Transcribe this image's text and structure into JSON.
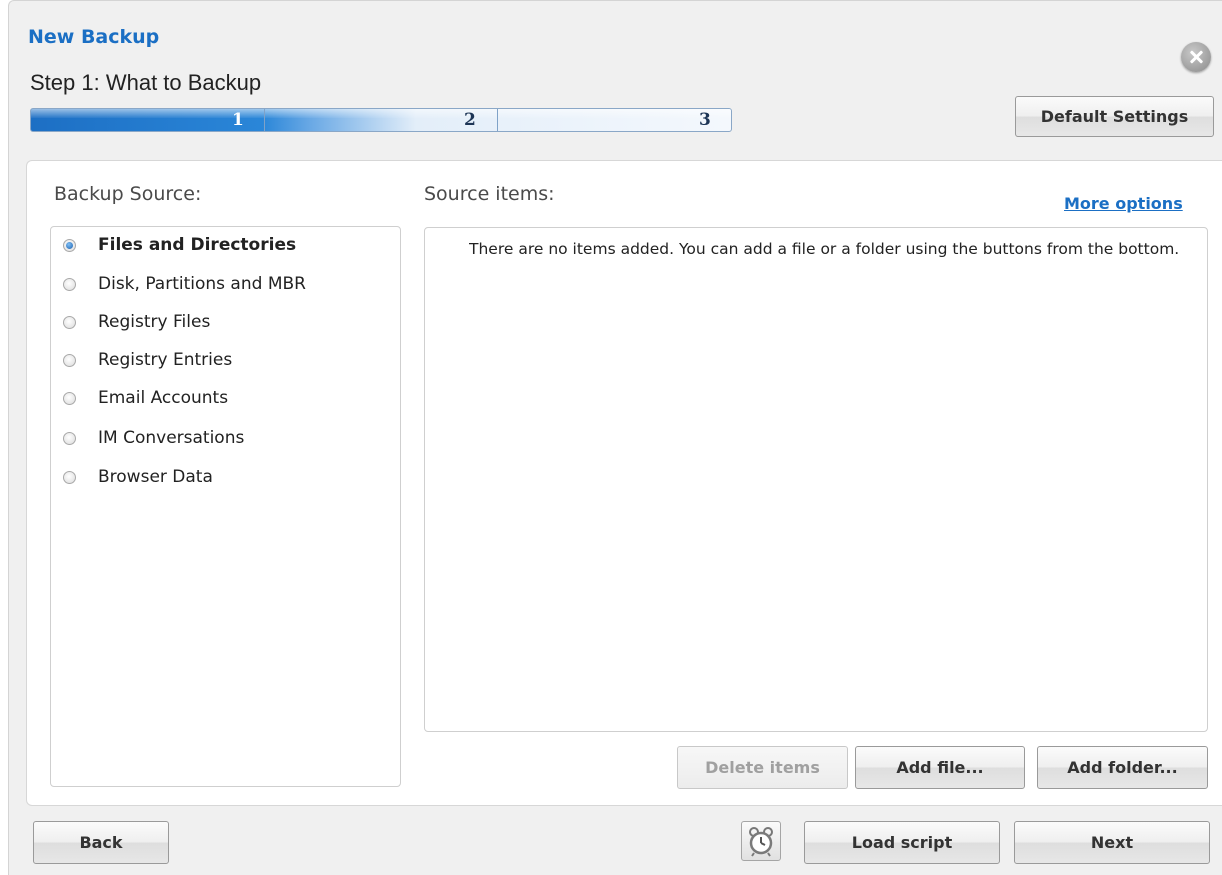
{
  "dialog": {
    "title": "New Backup",
    "step_title": "Step 1: What to Backup",
    "progress": {
      "current_step": 1,
      "total_steps": 3,
      "steps": [
        "1",
        "2",
        "3"
      ]
    },
    "default_settings_label": "Default Settings"
  },
  "backup_source": {
    "heading": "Backup Source:",
    "options": [
      {
        "label": "Files and Directories",
        "selected": true
      },
      {
        "label": "Disk, Partitions and MBR",
        "selected": false
      },
      {
        "label": "Registry Files",
        "selected": false
      },
      {
        "label": "Registry Entries",
        "selected": false
      },
      {
        "label": "Email Accounts",
        "selected": false
      },
      {
        "label": "IM Conversations",
        "selected": false
      },
      {
        "label": "Browser Data",
        "selected": false
      }
    ]
  },
  "source_items": {
    "heading": "Source items:",
    "more_options_label": "More options",
    "empty_message": "There are no items added. You can add a file or a folder using the buttons from the bottom.",
    "delete_label": "Delete items",
    "add_file_label": "Add file...",
    "add_folder_label": "Add folder..."
  },
  "footer": {
    "back_label": "Back",
    "load_script_label": "Load script",
    "next_label": "Next",
    "schedule_icon": "alarm-clock-icon"
  },
  "colors": {
    "accent": "#1b6fc4",
    "window_bg": "#f0f0f0"
  }
}
